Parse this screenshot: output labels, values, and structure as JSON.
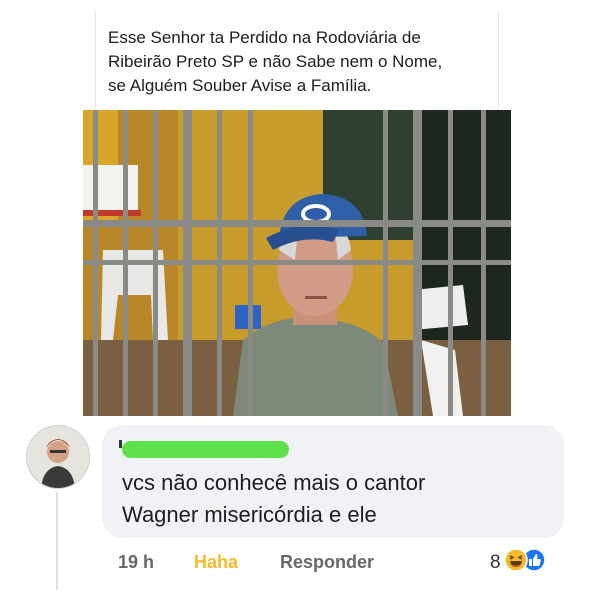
{
  "post": {
    "lines": [
      "Esse Senhor ta Perdido na Rodoviária de",
      "Ribeirão Preto SP e não Sabe nem o Nome,",
      "se Alguém Souber Avise a Família."
    ]
  },
  "comment": {
    "lines": [
      "vcs não  conhecê  mais o cantor",
      "Wagner  misericórdia  e ele"
    ]
  },
  "actions": {
    "time": "19 h",
    "reaction": "Haha",
    "reply": "Responder"
  },
  "reactions": {
    "count": "8",
    "icons": [
      "haha-icon",
      "like-icon"
    ]
  },
  "colors": {
    "haha": "#f7b928",
    "bubble": "#f0f2f5",
    "redaction": "#5ee04b",
    "like": "#1877f2"
  }
}
